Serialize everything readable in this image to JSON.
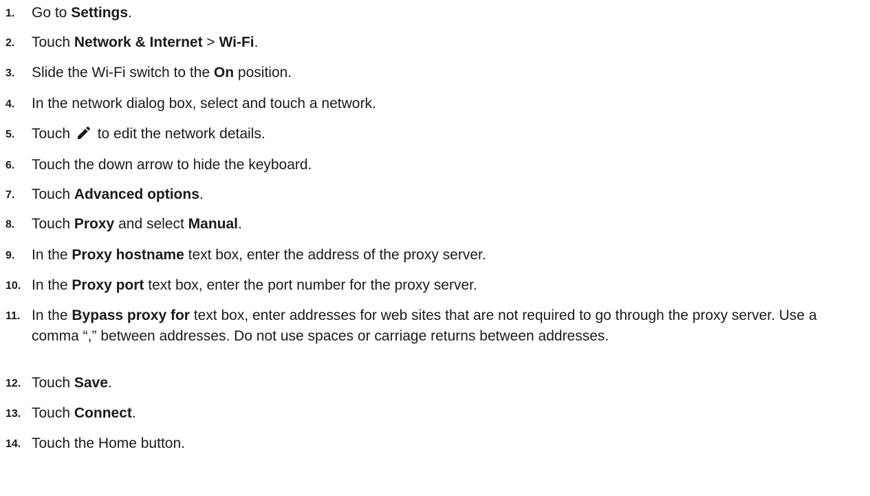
{
  "steps": [
    {
      "num": "1.",
      "parts": [
        {
          "t": "Go to "
        },
        {
          "t": "Settings",
          "b": true
        },
        {
          "t": "."
        }
      ]
    },
    {
      "num": "2.",
      "parts": [
        {
          "t": "Touch "
        },
        {
          "t": "Network & Internet",
          "b": true
        },
        {
          "t": " > "
        },
        {
          "t": "Wi-Fi",
          "b": true
        },
        {
          "t": "."
        }
      ]
    },
    {
      "num": "3.",
      "parts": [
        {
          "t": "Slide the Wi-Fi switch to the "
        },
        {
          "t": "On",
          "b": true
        },
        {
          "t": " position."
        }
      ]
    },
    {
      "num": "4.",
      "parts": [
        {
          "t": "In the network dialog box, select and touch a network."
        }
      ]
    },
    {
      "num": "5.",
      "parts": [
        {
          "t": "Touch "
        },
        {
          "icon": "pencil-icon"
        },
        {
          "t": " to edit the network details."
        }
      ]
    },
    {
      "num": "6.",
      "parts": [
        {
          "t": "Touch the down arrow to hide the keyboard."
        }
      ]
    },
    {
      "num": "7.",
      "parts": [
        {
          "t": "Touch "
        },
        {
          "t": "Advanced options",
          "b": true
        },
        {
          "t": "."
        }
      ]
    },
    {
      "num": "8.",
      "parts": [
        {
          "t": "Touch "
        },
        {
          "t": "Proxy",
          "b": true
        },
        {
          "t": " and select "
        },
        {
          "t": "Manual",
          "b": true
        },
        {
          "t": "."
        }
      ]
    },
    {
      "num": "9.",
      "parts": [
        {
          "t": "In the "
        },
        {
          "t": "Proxy hostname",
          "b": true
        },
        {
          "t": " text box, enter the address of the proxy server."
        }
      ]
    },
    {
      "num": "10.",
      "parts": [
        {
          "t": "In the "
        },
        {
          "t": "Proxy port",
          "b": true
        },
        {
          "t": " text box, enter the port number for the proxy server."
        }
      ]
    },
    {
      "num": "11.",
      "parts": [
        {
          "t": "In the "
        },
        {
          "t": "Bypass proxy for",
          "b": true
        },
        {
          "t": " text box, enter addresses for web sites that are not required to go through the proxy server. Use a comma “,” between addresses. Do not use spaces or carriage returns between addresses."
        }
      ]
    },
    {
      "num": "12.",
      "parts": [
        {
          "t": "Touch "
        },
        {
          "t": "Save",
          "b": true
        },
        {
          "t": "."
        }
      ]
    },
    {
      "num": "13.",
      "parts": [
        {
          "t": "Touch "
        },
        {
          "t": "Connect",
          "b": true
        },
        {
          "t": "."
        }
      ]
    },
    {
      "num": "14.",
      "parts": [
        {
          "t": "Touch the Home button."
        }
      ]
    }
  ],
  "colors": {
    "text": "#1a1a1a",
    "background": "#ffffff"
  }
}
